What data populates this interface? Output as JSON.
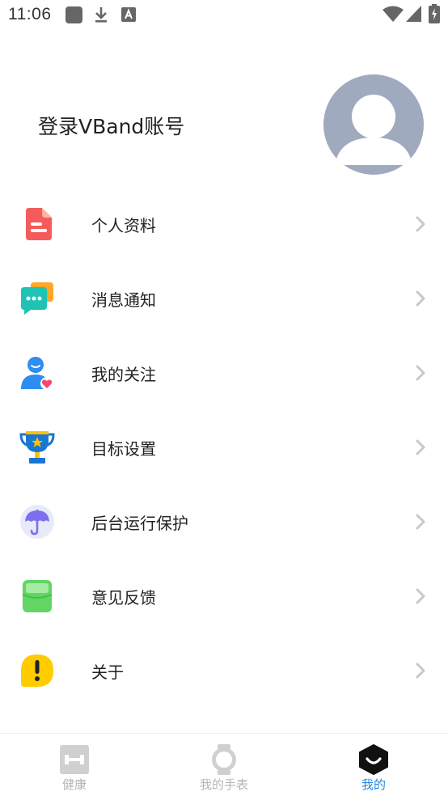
{
  "status_bar": {
    "time": "11:06",
    "icons": [
      "app-square-icon",
      "download-icon",
      "a-badge-icon",
      "wifi-icon",
      "signal-icon",
      "battery-icon"
    ]
  },
  "header": {
    "login_text": "登录VBand账号",
    "avatar_icon": "default-avatar-icon"
  },
  "menu": {
    "items": [
      {
        "label": "个人资料",
        "icon": "profile-doc-icon"
      },
      {
        "label": "消息通知",
        "icon": "message-bubble-icon"
      },
      {
        "label": "我的关注",
        "icon": "follow-person-icon"
      },
      {
        "label": "目标设置",
        "icon": "trophy-icon"
      },
      {
        "label": "后台运行保护",
        "icon": "umbrella-icon"
      },
      {
        "label": "意见反馈",
        "icon": "feedback-box-icon"
      },
      {
        "label": "关于",
        "icon": "exclamation-icon"
      }
    ]
  },
  "bottom_nav": {
    "tabs": [
      {
        "label": "健康",
        "icon": "dumbbell-icon",
        "active": false
      },
      {
        "label": "我的手表",
        "icon": "watch-icon",
        "active": false
      },
      {
        "label": "我的",
        "icon": "smile-hexagon-icon",
        "active": true
      }
    ]
  },
  "colors": {
    "accent": "#1e88e5",
    "inactive": "#b5b5b5",
    "avatar_bg": "#a0aabf",
    "chevron": "#c8c8c8"
  }
}
